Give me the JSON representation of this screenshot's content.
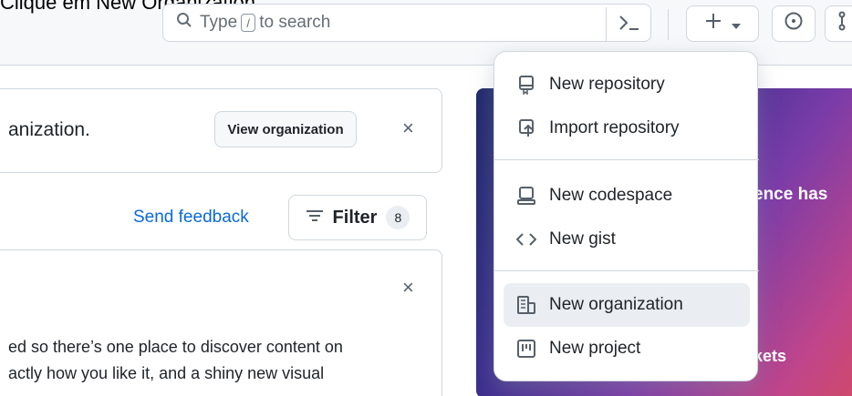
{
  "instruction": "Clique em New Organization.",
  "header": {
    "search_placeholder_prefix": "Type",
    "search_key": "/",
    "search_placeholder_suffix": "to search",
    "command_icon": "terminal-icon",
    "create_icon": "plus-icon",
    "issues_icon": "issue-circle-icon",
    "pr_icon": "pull-request-icon"
  },
  "banner": {
    "text": "anization.",
    "button": "View organization",
    "close": "×"
  },
  "toolbar": {
    "feedback": "Send feedback",
    "filter": "Filter",
    "filter_count": "8"
  },
  "feed_card": {
    "close": "×",
    "line1": "ed so there’s one place to discover content on",
    "line2": "actly how you like it, and a shiny new visual"
  },
  "promo": {
    "line1": "ence has",
    "line2": "kets",
    "colors": [
      "#1f2a6b",
      "#7a3ca8",
      "#d24a66"
    ]
  },
  "menu": {
    "group1": [
      {
        "label": "New repository",
        "icon": "repo-icon"
      },
      {
        "label": "Import repository",
        "icon": "repo-push-icon"
      }
    ],
    "group2": [
      {
        "label": "New codespace",
        "icon": "codespace-icon"
      },
      {
        "label": "New gist",
        "icon": "code-icon"
      }
    ],
    "group3": [
      {
        "label": "New organization",
        "icon": "organization-icon",
        "selected": true
      },
      {
        "label": "New project",
        "icon": "project-icon"
      }
    ]
  }
}
